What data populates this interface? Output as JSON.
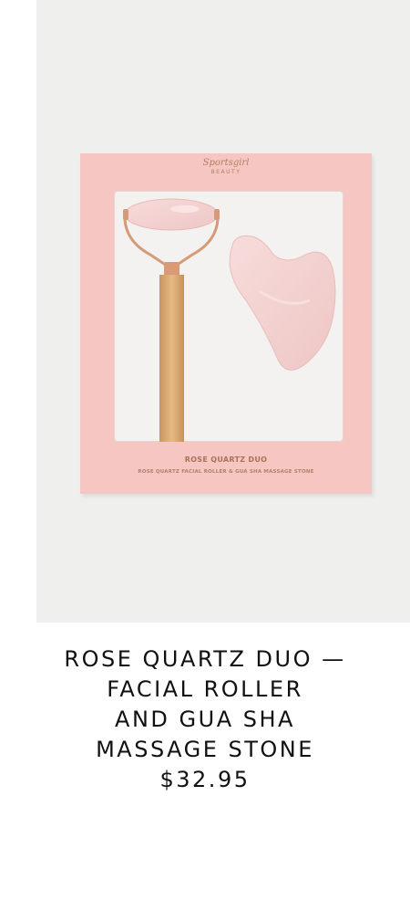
{
  "product": {
    "image": {
      "brand_script": "Sportsgirl",
      "brand_sub": "BEAUTY",
      "box_title": "ROSE QUARTZ DUO",
      "box_subtitle": "ROSE QUARTZ FACIAL ROLLER & GUA SHA MASSAGE STONE"
    },
    "title_lines": [
      "ROSE QUARTZ DUO —",
      "FACIAL ROLLER",
      "AND GUA SHA",
      "MASSAGE STONE"
    ],
    "price": "$32.95"
  },
  "colors": {
    "box_pink": "#f6c7c2",
    "rose_gold": "#d9a07e",
    "quartz": "#f3d3d2",
    "text": "#111111"
  }
}
